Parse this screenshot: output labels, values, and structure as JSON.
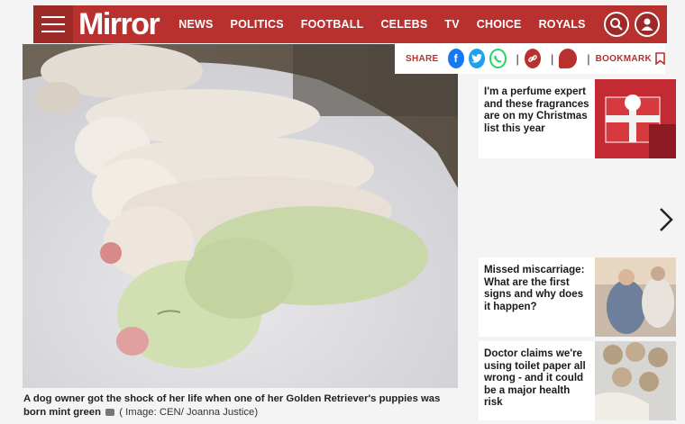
{
  "header": {
    "logo": "Mirror",
    "nav": [
      "NEWS",
      "POLITICS",
      "FOOTBALL",
      "CELEBS",
      "TV",
      "CHOICE",
      "ROYALS"
    ]
  },
  "share": {
    "label": "SHARE",
    "bookmark_label": "BOOKMARK"
  },
  "article": {
    "caption_main": "A dog owner got the shock of her life when one of her Golden Retriever's puppies was born mint green",
    "caption_credit": "( Image: CEN/ Joanna Justice)"
  },
  "sidebar": {
    "cards": [
      {
        "title": "I'm a perfume expert and these fragrances are on my Christmas list this year"
      },
      {
        "title": "Missed miscarriage: What are the first signs and why does it happen?"
      },
      {
        "title": "Doctor claims we're using toilet paper all wrong - and it could be a major health risk"
      }
    ]
  },
  "colors": {
    "brand": "#b9312e",
    "facebook": "#1877f2",
    "twitter": "#1da1f2",
    "whatsapp": "#25d366"
  }
}
